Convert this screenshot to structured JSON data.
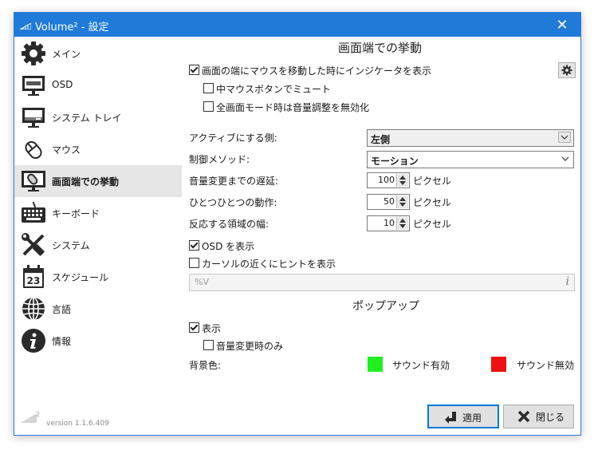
{
  "window": {
    "title": "Volume² - 設定",
    "close_glyph": "✕",
    "accent_color": "#1f7ad8"
  },
  "sidebar": {
    "items": [
      {
        "label": "メイン",
        "icon": "gear-icon"
      },
      {
        "label": "OSD",
        "icon": "monitor-icon"
      },
      {
        "label": "システム トレイ",
        "icon": "system-tray-icon"
      },
      {
        "label": "マウス",
        "icon": "mouse-icon"
      },
      {
        "label": "画面端での挙動",
        "icon": "screen-edge-icon"
      },
      {
        "label": "キーボード",
        "icon": "keyboard-icon"
      },
      {
        "label": "システム",
        "icon": "wrench-screwdriver-icon"
      },
      {
        "label": "スケジュール",
        "icon": "calendar-icon"
      },
      {
        "label": "言語",
        "icon": "globe-icon"
      },
      {
        "label": "情報",
        "icon": "info-icon"
      }
    ],
    "selected_index": 4,
    "calendar_day": "23",
    "version": "version 1.1.6.409",
    "logo_superscript": "2"
  },
  "content": {
    "heading": "画面端での挙動",
    "show_indicator": {
      "label": "画面の端にマウスを移動した時にインジケータを表示",
      "checked": true
    },
    "middle_button_mute": {
      "label": "中マウスボタンでミュート",
      "checked": false
    },
    "fullscreen_disable": {
      "label": "全画面モード時は音量調整を無効化",
      "checked": false
    },
    "active_side": {
      "label": "アクティブにする側:",
      "value": "左側"
    },
    "control_method": {
      "label": "制御メソッド:",
      "value": "モーション"
    },
    "delay": {
      "label": "音量変更までの遅延:",
      "value": "100",
      "unit": "ピクセル"
    },
    "step": {
      "label": "ひとつひとつの動作:",
      "value": "50",
      "unit": "ピクセル"
    },
    "area_width": {
      "label": "反応する領域の幅:",
      "value": "10",
      "unit": "ピクセル"
    },
    "show_osd": {
      "label": "OSD を表示",
      "checked": true
    },
    "show_hint": {
      "label": "カーソルの近くにヒントを表示",
      "checked": false
    },
    "hint_format": {
      "placeholder": "%V",
      "info_glyph": "i"
    },
    "popup": {
      "heading": "ポップアップ",
      "show": {
        "label": "表示",
        "checked": true
      },
      "only_on_change": {
        "label": "音量変更時のみ",
        "checked": false
      },
      "bg_color_label": "背景色:",
      "sound_on": {
        "label": "サウンド有効",
        "color": "#22ee22"
      },
      "sound_off": {
        "label": "サウンド無効",
        "color": "#ee1111"
      }
    }
  },
  "buttons": {
    "apply": "適用",
    "close": "閉じる"
  }
}
